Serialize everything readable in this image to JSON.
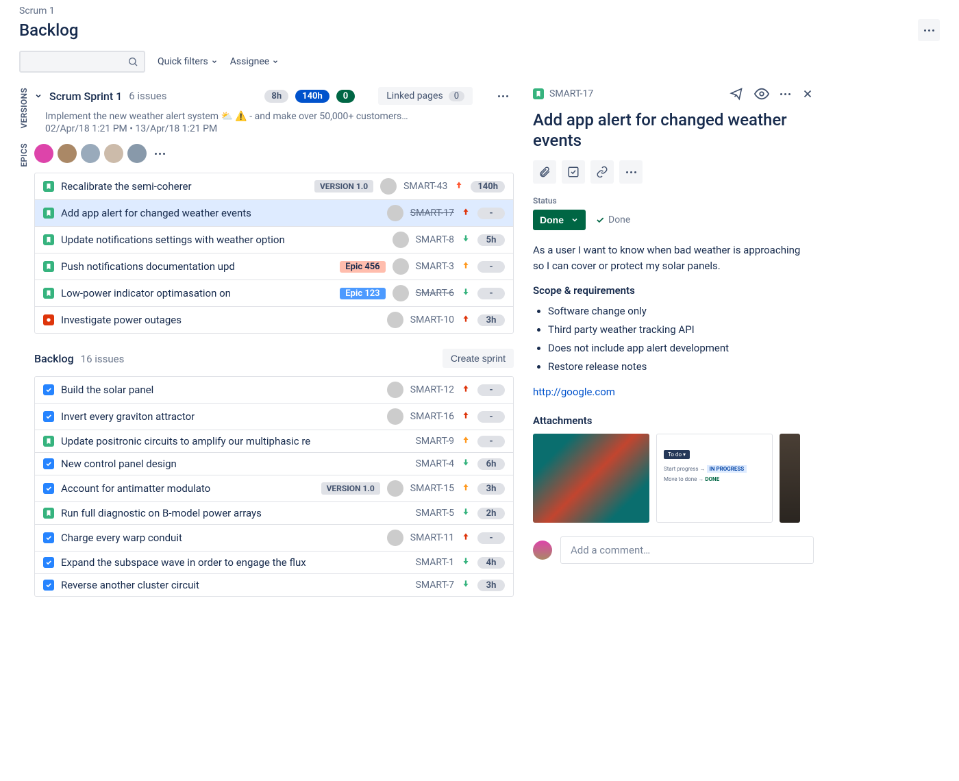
{
  "breadcrumb": "Scrum 1",
  "page_title": "Backlog",
  "filters": {
    "quick": "Quick filters",
    "assignee": "Assignee"
  },
  "sidetabs": {
    "versions": "VERSIONS",
    "epics": "EPICS"
  },
  "sprint": {
    "name": "Scrum Sprint 1",
    "count": "6 issues",
    "pills": {
      "grey": "8h",
      "blue": "140h",
      "green": "0"
    },
    "linked_label": "Linked pages",
    "linked_count": "0",
    "desc": "Implement the new weather alert system ⛅ ⚠️ - and make over 50,000+ customers…",
    "dates": "02/Apr/18 1:21 PM • 13/Apr/18 1:21 PM",
    "issues": [
      {
        "type": "story",
        "title": "Recalibrate the semi-coherer",
        "version": "VERSION 1.0",
        "key": "SMART-43",
        "prio_color": "#FF5630",
        "prio_dir": "up",
        "est": "140h",
        "struck": false
      },
      {
        "type": "story",
        "title": "Add app alert for changed weather events",
        "key": "SMART-17",
        "prio_color": "#DE350B",
        "prio_dir": "up",
        "est": "-",
        "struck": true,
        "selected": true
      },
      {
        "type": "story",
        "title": "Update notifications settings with weather option",
        "key": "SMART-8",
        "prio_color": "#36B37E",
        "prio_dir": "down",
        "est": "5h",
        "struck": false
      },
      {
        "type": "story",
        "title": "Push notifications documentation upd",
        "epic": {
          "label": "Epic 456",
          "bg": "#FFBDAD",
          "fg": "#172B4D"
        },
        "key": "SMART-3",
        "prio_color": "#FF991F",
        "prio_dir": "up",
        "est": "-",
        "struck": false
      },
      {
        "type": "story",
        "title": "Low-power indicator optimasation on",
        "epic": {
          "label": "Epic 123",
          "bg": "#4C9AFF",
          "fg": "#fff"
        },
        "key": "SMART-6",
        "prio_color": "#36B37E",
        "prio_dir": "down",
        "est": "-",
        "struck": true
      },
      {
        "type": "bug",
        "title": "Investigate power outages",
        "key": "SMART-10",
        "prio_color": "#DE350B",
        "prio_dir": "up",
        "est": "3h",
        "struck": false
      }
    ]
  },
  "backlog": {
    "title": "Backlog",
    "count": "16 issues",
    "create_btn": "Create sprint",
    "issues": [
      {
        "type": "task",
        "title": "Build the solar panel",
        "key": "SMART-12",
        "prio_color": "#DE350B",
        "prio_dir": "up",
        "est": "-"
      },
      {
        "type": "task",
        "title": "Invert every graviton attractor",
        "key": "SMART-16",
        "prio_color": "#DE350B",
        "prio_dir": "up",
        "est": "-"
      },
      {
        "type": "story",
        "title": "Update positronic circuits to amplify our multiphasic re",
        "key": "SMART-9",
        "prio_color": "#FF991F",
        "prio_dir": "up",
        "est": "-",
        "noavatar": true
      },
      {
        "type": "task",
        "title": "New control panel design",
        "key": "SMART-4",
        "prio_color": "#36B37E",
        "prio_dir": "down",
        "est": "6h",
        "noavatar": true
      },
      {
        "type": "task",
        "title": "Account for antimatter modulato",
        "version": "VERSION 1.0",
        "key": "SMART-15",
        "prio_color": "#FF991F",
        "prio_dir": "up",
        "est": "3h"
      },
      {
        "type": "story",
        "title": "Run full diagnostic on B-model power arrays",
        "key": "SMART-5",
        "prio_color": "#36B37E",
        "prio_dir": "down",
        "est": "2h",
        "noavatar": true
      },
      {
        "type": "task",
        "title": "Charge every warp conduit",
        "key": "SMART-11",
        "prio_color": "#DE350B",
        "prio_dir": "up",
        "est": "-"
      },
      {
        "type": "task",
        "title": "Expand the subspace wave in order to engage the flux",
        "key": "SMART-1",
        "prio_color": "#36B37E",
        "prio_dir": "down",
        "est": "4h",
        "noavatar": true
      },
      {
        "type": "task",
        "title": "Reverse another cluster circuit",
        "key": "SMART-7",
        "prio_color": "#36B37E",
        "prio_dir": "down",
        "est": "3h",
        "noavatar": true
      }
    ]
  },
  "detail": {
    "key": "SMART-17",
    "title": "Add app alert for changed weather events",
    "status_label": "Status",
    "status_value": "Done",
    "status_done": "Done",
    "description": "As a user I want to know when bad weather is approaching so I can cover or protect my solar panels.",
    "scope_heading": "Scope & requirements",
    "scope_items": [
      "Software change only",
      "Third party weather tracking API",
      "Does not include app alert development",
      "Restore release notes"
    ],
    "link": "http://google.com",
    "attachments_heading": "Attachments",
    "comment_placeholder": "Add a comment…"
  }
}
